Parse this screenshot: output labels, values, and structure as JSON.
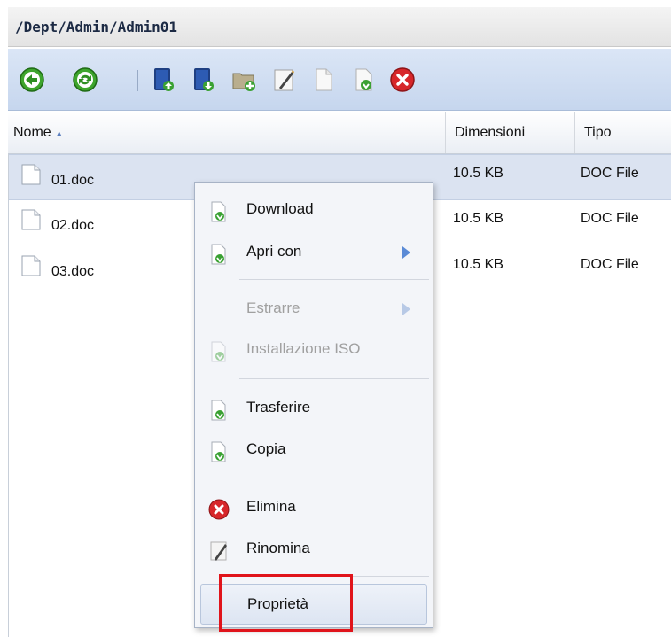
{
  "path": "/Dept/Admin/Admin01",
  "toolbar": {
    "buttons": [
      "back-icon",
      "refresh-icon",
      "upload-icon",
      "download-icon",
      "new-folder-icon",
      "rename-icon",
      "copy-icon",
      "move-icon",
      "delete-icon"
    ]
  },
  "columns": {
    "name": "Nome",
    "sort": "▲",
    "size": "Dimensioni",
    "type": "Tipo"
  },
  "files": [
    {
      "name": "01.doc",
      "size": "10.5 KB",
      "type": "DOC File",
      "selected": true
    },
    {
      "name": "02.doc",
      "size": "10.5 KB",
      "type": "DOC File",
      "selected": false
    },
    {
      "name": "03.doc",
      "size": "10.5 KB",
      "type": "DOC File",
      "selected": false
    }
  ],
  "context_menu": {
    "download": "Download",
    "open_with": "Apri con",
    "extract": "Estrarre",
    "iso": "Installazione ISO",
    "transfer": "Trasferire",
    "copy": "Copia",
    "delete": "Elimina",
    "rename": "Rinomina",
    "properties": "Proprietà"
  },
  "colors": {
    "highlight_box": "#e0141b",
    "selection": "#dbe3f1",
    "toolbar": "#c6d6ee"
  }
}
